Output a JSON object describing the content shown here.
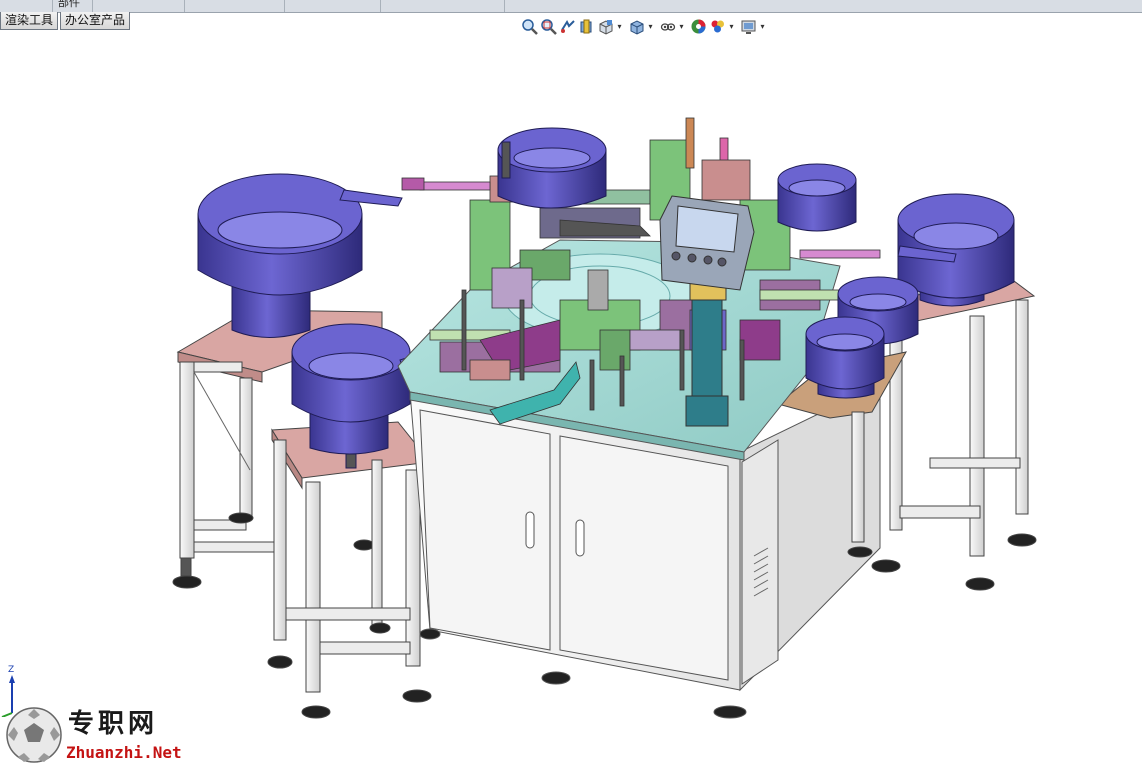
{
  "window": {
    "top_tab_text": "部件"
  },
  "tabs": [
    {
      "label": "渲染工具"
    },
    {
      "label": "办公室产品"
    }
  ],
  "view_toolbar": {
    "icons": [
      "zoom-to-fit-icon",
      "zoom-to-area-icon",
      "previous-view-icon",
      "section-view-icon",
      "view-orientation-icon",
      "display-style-icon",
      "hide-show-items-icon",
      "edit-appearance-icon",
      "apply-scene-icon",
      "view-settings-icon"
    ]
  },
  "triad": {
    "axis_label": "Z"
  },
  "watermark": {
    "logo_text": "专职网",
    "url_text": "Zhuanzhi.Net"
  },
  "colors": {
    "bowl": "#4b45a8",
    "bowl_light": "#6f68d6",
    "plate": "#a8ddd8",
    "cabinet": "#f2f2f2",
    "stand_top": "#d9a6a3",
    "frame": "#eeeeee",
    "brand_red": "#c41313"
  }
}
